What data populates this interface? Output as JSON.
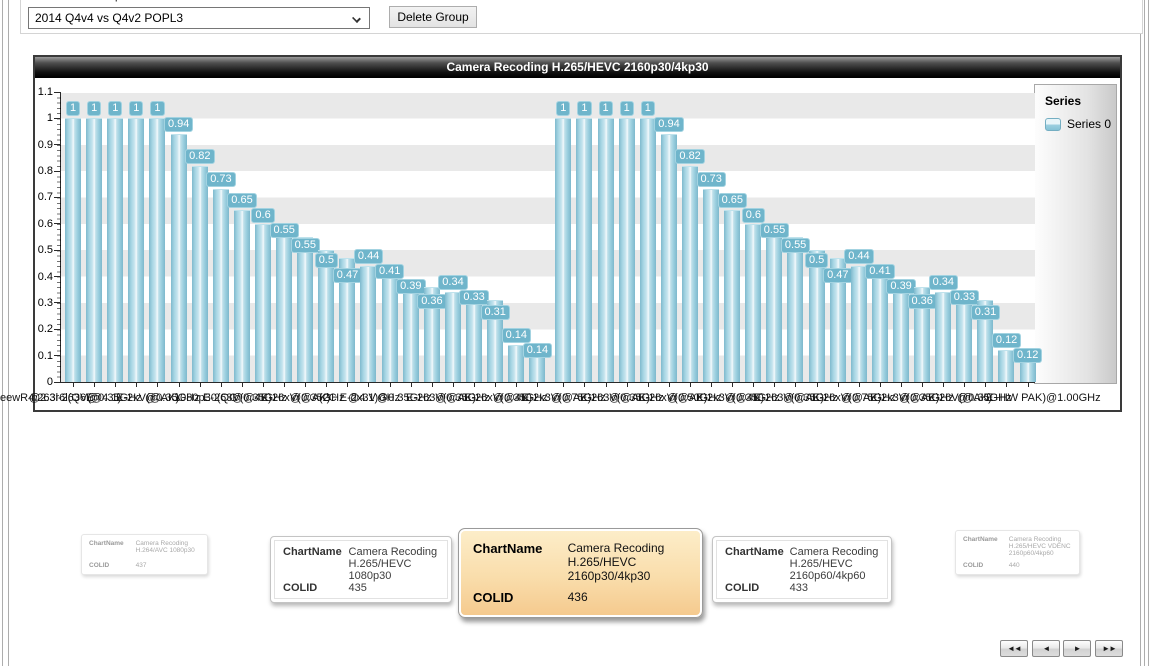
{
  "top_bar": {
    "clipped_group_label": "Select Chart Group",
    "group_selector_value": "2014 Q4v4 vs Q4v2 POPL3",
    "delete_button_label": "Delete Group"
  },
  "chart_data": {
    "type": "bar",
    "title": "Camera Recoding H.265/HEVC 2160p30/4kp30",
    "ylim": [
      0,
      1.1
    ],
    "y_ticks": [
      "0",
      "0.1",
      "0.2",
      "0.3",
      "0.4",
      "0.5",
      "0.6",
      "0.7",
      "0.8",
      "0.9",
      "1",
      "1.1"
    ],
    "legend_position": "right",
    "legend_title": "Series",
    "series": [
      {
        "name": "Series 0",
        "values": [
          1,
          1,
          1,
          1,
          1,
          0.94,
          0.82,
          0.73,
          0.65,
          0.6,
          0.55,
          0.55,
          0.5,
          0.47,
          0.44,
          0.41,
          0.39,
          0.36,
          0.34,
          0.33,
          0.31,
          0.14,
          0.14,
          1,
          1,
          1,
          1,
          1,
          0.94,
          0.82,
          0.73,
          0.65,
          0.6,
          0.55,
          0.55,
          0.5,
          0.47,
          0.44,
          0.41,
          0.39,
          0.36,
          0.34,
          0.33,
          0.31,
          0.12,
          0.12
        ]
      }
    ],
    "group_sizes": [
      23,
      23
    ],
    "gridlines": "alternating horizontal gray bands every 0.1",
    "x_tick_labels_note": "platform names, heavily overlapping and illegible",
    "x_label_fragments": [
      "eewR4.263l",
      "@2.3r6l(Q6E",
      "-263V(@4.1)",
      "@0.35GHz",
      "E-2xV(@AK)",
      "@0.35GHz",
      "1080p30(QC",
      "E-263V(@4K)",
      "@0.35GHz",
      "E-26xV(@AK)",
      "@0.35GHz",
      "(2C E-2x3V",
      "@4.1)GHz",
      "@0.35GHz",
      "E-263V(@AK)",
      "@0.35GHz",
      "E-26xV(@4K)",
      "@0.35GHz",
      "E-2x3V(@AK)",
      "@0.75GHz",
      "E-263V(@AK)",
      "@0.35GHz",
      "E-26xV(@AK)",
      "@0.50GHz",
      "E-2x3V(@4K)",
      "@0.35GHz",
      "E-263V(@AK)",
      "@0.35GHz",
      "E-26xV(@AK)",
      "@0.75GHz",
      "E-2x3V(@AK)",
      "@0.35GHz",
      "E-26V(@AK)",
      "@0.35GHz",
      "E+HW PAK)@1.00GHz"
    ],
    "colors": {
      "bar": "#9fd2e0",
      "bar_edge": "#7db8cc",
      "value_badge": "#6fb5cb",
      "band_gray": "#e9e9e9",
      "title_bar": "#1a1a1a"
    }
  },
  "legend": {
    "title": "Series",
    "items": [
      {
        "label": "Series 0",
        "color": "#8ecadb"
      }
    ]
  },
  "card_field_labels": {
    "name": "ChartName",
    "colid": "COLID"
  },
  "cards": [
    {
      "name": "Camera Recoding H.264/AVC 1080p30",
      "colid": "437",
      "state": "far"
    },
    {
      "name": "Camera Recoding H.265/HEVC 1080p30",
      "colid": "435",
      "state": "near"
    },
    {
      "name": "Camera Recoding H.265/HEVC 2160p30/4kp30",
      "colid": "436",
      "state": "selected"
    },
    {
      "name": "Camera Recoding H.265/HEVC 2160p60/4kp60",
      "colid": "433",
      "state": "near"
    },
    {
      "name": "Camera Recoding H.265/HEVC VDENC 2160p60/4kp60",
      "colid": "440",
      "state": "far"
    }
  ],
  "selected_card_color": "#f6c98c",
  "pager": {
    "buttons": [
      {
        "name": "first",
        "glyph": "◄◄"
      },
      {
        "name": "prev",
        "glyph": "◄"
      },
      {
        "name": "next",
        "glyph": "►"
      },
      {
        "name": "last",
        "glyph": "►►"
      }
    ]
  }
}
